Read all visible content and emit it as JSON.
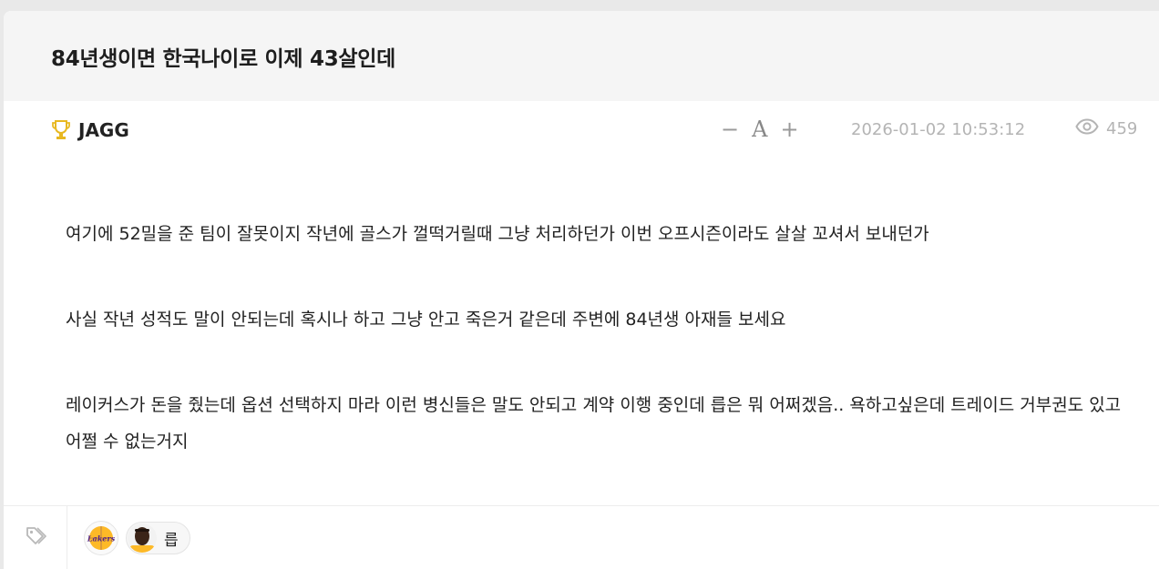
{
  "post": {
    "title": "84년생이면 한국나이로 이제 43살인데",
    "author": "JAGG",
    "font_controls": {
      "decrease": "−",
      "font": "A",
      "increase": "+"
    },
    "date": "2026-01-02 10:53:12",
    "views": "459",
    "paragraphs": [
      "여기에 52밀을 준 팀이 잘못이지 작년에 골스가 껄떡거릴때 그냥 처리하던가 이번 오프시즌이라도 살살 꼬셔서 보내던가",
      "사실 작년 성적도 말이 안되는데 혹시나 하고 그냥 안고 죽은거 같은데 주변에 84년생 아재들 보세요",
      "레이커스가 돈을 줬는데 옵션 선택하지 마라 이런 병신들은 말도 안되고 계약 이행 중인데 릅은 뭐 어쩌겠음.. 욕하고싶은데 트레이드 거부권도 있고 어쩔 수 없는거지"
    ]
  },
  "tags": {
    "team_logo_text": "Lakers",
    "player_label": "릅"
  },
  "colors": {
    "trophy": "#e8b820",
    "lakers_purple": "#552583",
    "lakers_gold": "#fdb927"
  },
  "icons": [
    "trophy-icon",
    "eye-icon",
    "tag-icon",
    "lakers-logo",
    "player-avatar"
  ]
}
